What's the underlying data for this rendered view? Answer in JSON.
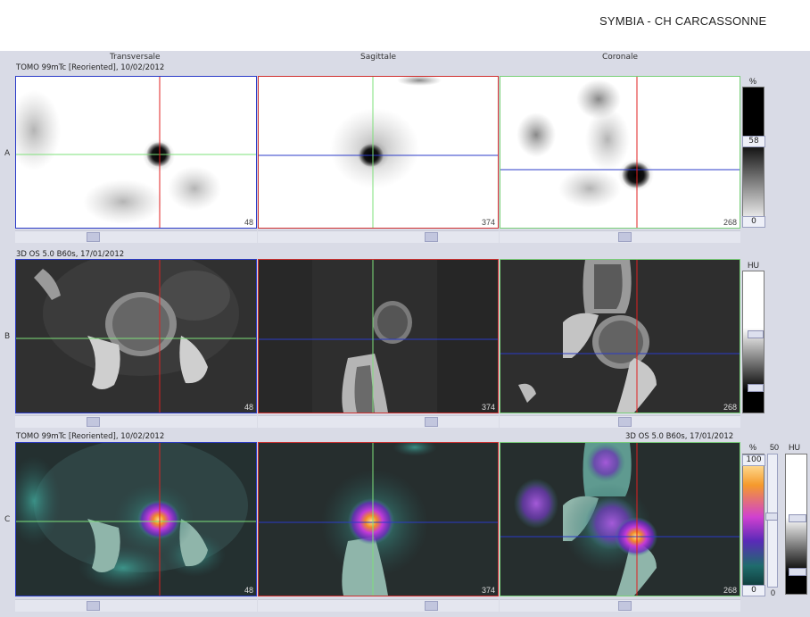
{
  "header": {
    "hospital": "SYMBIA - CH CARCASSONNE"
  },
  "columns": [
    "Transversale",
    "Sagittale",
    "Coronale"
  ],
  "rows": [
    {
      "id": "A",
      "series_label": "TOMO 99mTc [Reoriented], 10/02/2012",
      "slices": [
        "48",
        "374",
        "268"
      ]
    },
    {
      "id": "B",
      "series_label": "3D  OS  5.0  B60s, 17/01/2012",
      "slices": [
        "48",
        "374",
        "268"
      ]
    },
    {
      "id": "C",
      "series_label": "TOMO 99mTc [Reoriented], 10/02/2012",
      "series_label_right": "3D  OS  5.0  B60s, 17/01/2012",
      "slices": [
        "48",
        "374",
        "268"
      ]
    }
  ],
  "scales": {
    "a": {
      "unit": "%",
      "top": "58",
      "bottom": "0"
    },
    "b": {
      "unit": "HU"
    },
    "c": {
      "unit_pct": "%",
      "top": "100",
      "bottom": "0",
      "mid": "50",
      "unit_hu": "HU",
      "small_bottom": "0"
    }
  },
  "colors": {
    "crosshair_h": "#2b3bc8",
    "crosshair_green": "#7ee07a",
    "crosshair_red": "#e02020",
    "frame_transversal": "#2b3bc8",
    "frame_sagittal": "#d03030",
    "frame_coronal": "#79d079"
  }
}
